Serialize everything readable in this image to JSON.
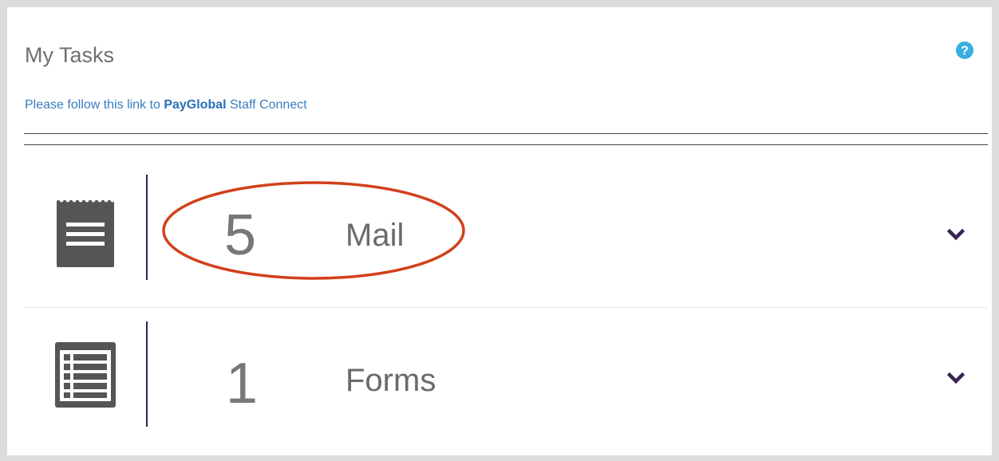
{
  "widget": {
    "title": "My Tasks",
    "help_icon": "question-circle-icon",
    "link_prefix": "Please follow this link to ",
    "link_brand": "PayGlobal",
    "link_suffix": " Staff Connect"
  },
  "tasks": [
    {
      "count": "5",
      "label": "Mail",
      "icon": "notepad-icon",
      "expand_icon": "chevron-down-icon"
    },
    {
      "count": "1",
      "label": "Forms",
      "icon": "list-form-icon",
      "expand_icon": "chevron-down-icon"
    }
  ],
  "colors": {
    "accent_bar": "#3a2350",
    "link": "#3a7cc2",
    "help": "#3aaee0",
    "annotation": "#d2401c"
  }
}
